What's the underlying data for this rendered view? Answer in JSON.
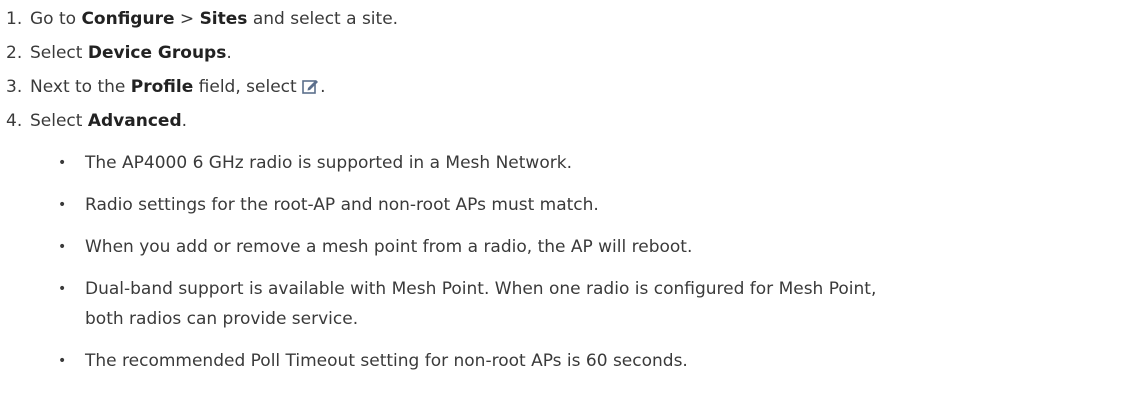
{
  "steps": [
    {
      "num": "1.",
      "p1": "Go to ",
      "b1": "Configure",
      "p2": " > ",
      "b2": "Sites",
      "p3": " and select a site."
    },
    {
      "num": "2.",
      "p1": "Select ",
      "b1": "Device Groups",
      "p2": "."
    },
    {
      "num": "3.",
      "p1": "Next to the ",
      "b1": "Profile",
      "p2": " field, select ",
      "p3": ".",
      "icon": "edit-icon"
    },
    {
      "num": "4.",
      "p1": "Select ",
      "b1": "Advanced",
      "p2": "."
    }
  ],
  "bullet_char": "•",
  "bullets": [
    "The AP4000 6 GHz radio is supported in a Mesh Network.",
    "Radio settings for the root-AP and non-root APs must match.",
    "When you add or remove a mesh point from a radio, the AP will reboot.",
    "Dual-band support is available with Mesh Point. When one radio is configured for Mesh Point,",
    "both radios can provide service.",
    "The recommended Poll Timeout setting for non-root APs is 60 seconds."
  ],
  "colors": {
    "text": "#3a3a3a",
    "icon": "#5b6f8c"
  }
}
